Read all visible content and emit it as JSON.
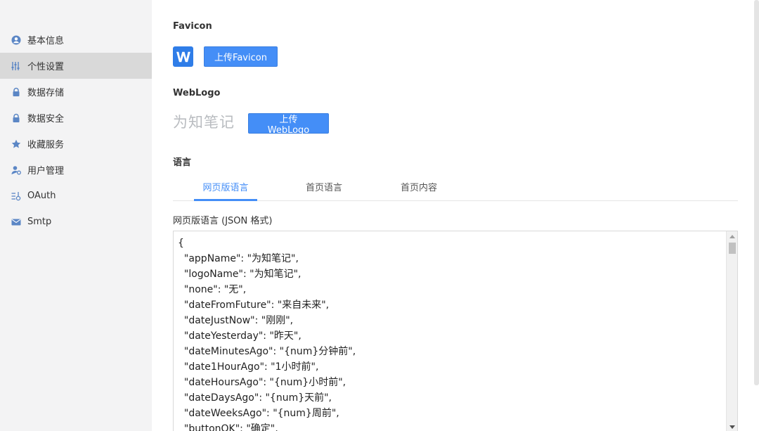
{
  "sidebar": {
    "items": [
      {
        "label": "基本信息",
        "icon": "user-circle-icon"
      },
      {
        "label": "个性设置",
        "icon": "sliders-icon",
        "active": true
      },
      {
        "label": "数据存储",
        "icon": "lock-icon"
      },
      {
        "label": "数据安全",
        "icon": "lock-icon"
      },
      {
        "label": "收藏服务",
        "icon": "star-icon"
      },
      {
        "label": "用户管理",
        "icon": "user-gear-icon"
      },
      {
        "label": "OAuth",
        "icon": "oauth-icon"
      },
      {
        "label": "Smtp",
        "icon": "mail-icon"
      }
    ]
  },
  "favicon": {
    "title": "Favicon",
    "upload_label": "上传Favicon",
    "icon": "wiz-w-logo-icon"
  },
  "weblogo": {
    "title": "WebLogo",
    "logo_text": "为知笔记",
    "upload_label": "上传WebLogo"
  },
  "language": {
    "title": "语言",
    "tabs": [
      {
        "label": "网页版语言",
        "active": true
      },
      {
        "label": "首页语言"
      },
      {
        "label": "首页内容"
      }
    ],
    "json_label": "网页版语言 (JSON 格式)",
    "code_lines": [
      "{",
      "  \"appName\": \"为知笔记\",",
      "  \"logoName\": \"为知笔记\",",
      "  \"none\": \"无\",",
      "  \"dateFromFuture\": \"来自未来\",",
      "  \"dateJustNow\": \"刚刚\",",
      "  \"dateYesterday\": \"昨天\",",
      "  \"dateMinutesAgo\": \"{num}分钟前\",",
      "  \"date1HourAgo\": \"1小时前\",",
      "  \"dateHoursAgo\": \"{num}小时前\",",
      "  \"dateDaysAgo\": \"{num}天前\",",
      "  \"dateWeeksAgo\": \"{num}周前\",",
      "  \"buttonOK\": \"确定\","
    ]
  },
  "colors": {
    "accent": "#448ef7",
    "sidebar_bg": "#f3f3f4",
    "sidebar_active": "#d9d9d9"
  }
}
